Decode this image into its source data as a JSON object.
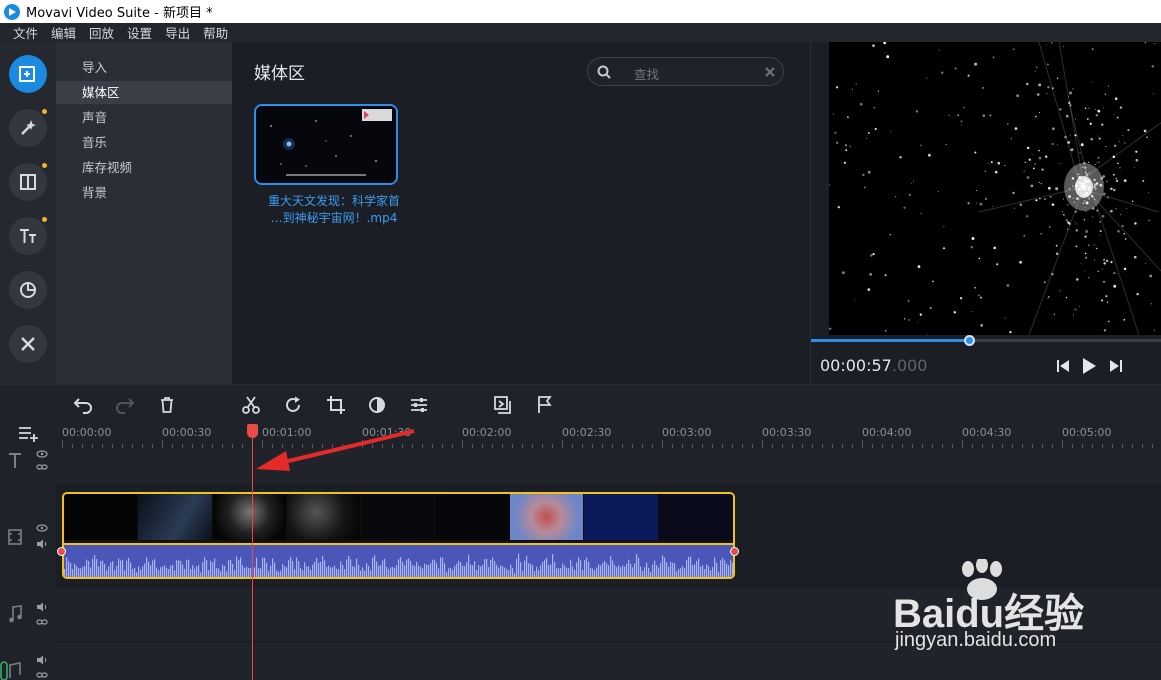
{
  "app": {
    "title": "Movavi Video Suite - 新项目 *"
  },
  "menu": [
    "文件",
    "编辑",
    "回放",
    "设置",
    "导出",
    "帮助"
  ],
  "categories": [
    "导入",
    "媒体区",
    "声音",
    "音乐",
    "库存视频",
    "背景"
  ],
  "selected_category": "媒体区",
  "media": {
    "title": "媒体区",
    "search_placeholder": "查找",
    "file_caption_line1": "重大天文发现：科学家首",
    "file_caption_line2": "…到神秘宇宙网！.mp4"
  },
  "preview": {
    "time_main": "00:00:57",
    "time_ms": ".000",
    "progress": 0.45
  },
  "ruler_ticks": [
    "00:00:00",
    "00:00:30",
    "00:01:00",
    "00:01:30",
    "00:02:00",
    "00:02:30",
    "00:03:00",
    "00:03:30",
    "00:04:00",
    "00:04:30",
    "00:05:00"
  ],
  "watermark": {
    "brand": "Baidu经验",
    "url": "jingyan.baidu.com"
  },
  "colors": {
    "accent": "#1a8be0",
    "clip_border": "#f0c21a",
    "audio_wave": "#4a57b8",
    "playhead": "#e94b4b"
  }
}
